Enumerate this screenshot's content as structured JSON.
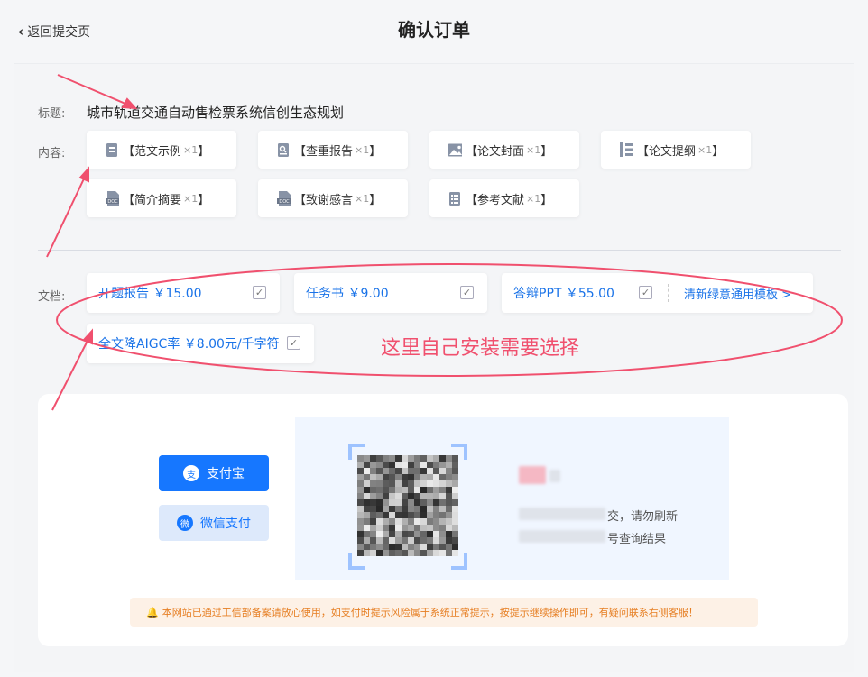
{
  "header": {
    "back_label": "返回提交页",
    "title": "确认订单"
  },
  "order": {
    "title_label": "标题:",
    "title_value": "城市轨道交通自动售检票系统信创生态规划",
    "content_label": "内容:",
    "content_items": [
      {
        "label": "【范文示例",
        "mult": "×1",
        "close": "】",
        "icon": "document-icon"
      },
      {
        "label": "【查重报告",
        "mult": "×1",
        "close": "】",
        "icon": "report-icon"
      },
      {
        "label": "【论文封面",
        "mult": "×1",
        "close": "】",
        "icon": "image-icon"
      },
      {
        "label": "【论文提纲",
        "mult": "×1",
        "close": "】",
        "icon": "outline-icon"
      },
      {
        "label": "【简介摘要",
        "mult": "×1",
        "close": "】",
        "icon": "doc-file-icon"
      },
      {
        "label": "【致谢感言",
        "mult": "×1",
        "close": "】",
        "icon": "doc-file-icon"
      },
      {
        "label": "【参考文献",
        "mult": "×1",
        "close": "】",
        "icon": "list-icon"
      }
    ],
    "docs_label": "文档:",
    "docs": [
      {
        "name": "开题报告",
        "price": "￥15.00"
      },
      {
        "name": "任务书",
        "price": "￥9.00"
      },
      {
        "name": "答辩PPT",
        "price": "￥55.00",
        "template": "清新绿意通用模板 >"
      },
      {
        "name": "全文降AIGC率",
        "price": "￥8.00元/千字符"
      }
    ],
    "check_glyph": "✓"
  },
  "annotation": {
    "text": "这里自己安装需要选择",
    "color": "#f0506e"
  },
  "payment": {
    "alipay_label": "支付宝",
    "alipay_glyph": "支",
    "wechat_label": "微信支付",
    "wechat_glyph": "微",
    "line1_suffix": "交，请勿刷新",
    "line2_suffix": "号查询结果",
    "notice_icon": "bell-icon",
    "notice_glyph": "🔔",
    "notice": "本网站已通过工信部备案请放心使用，如支付时提示风险属于系统正常提示，按提示继续操作即可，有疑问联系右侧客服！"
  },
  "colors": {
    "accent": "#1677ff",
    "notice_bg": "#fdf1e6",
    "notice_text": "#e67e22"
  }
}
